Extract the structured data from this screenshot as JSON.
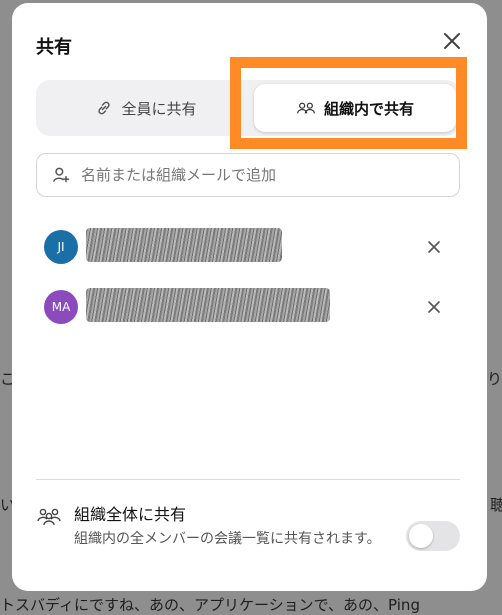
{
  "background": {
    "text_right_1": "り",
    "text_left_1": "こ",
    "text_right_2": "聴",
    "text_left_2": "い",
    "bottom_line": "トスバディにですね、あの、アプリケーションで、あの、Ping"
  },
  "dialog": {
    "title": "共有",
    "close_icon": "close-icon",
    "tabs": [
      {
        "label": "全員に共有",
        "icon": "link-icon",
        "selected": false
      },
      {
        "label": "組織内で共有",
        "icon": "people-icon",
        "selected": true
      }
    ],
    "search": {
      "placeholder": "名前または組織メールで追加",
      "value": "",
      "icon": "add-person-icon"
    },
    "members": [
      {
        "initials": "JI",
        "color": "#1a6fa6",
        "redacted": true
      },
      {
        "initials": "MA",
        "color": "#8c4bbd",
        "redacted": true
      }
    ],
    "org_share": {
      "title": "組織全体に共有",
      "description": "組織内の全メンバーの会議一覧に共有されます。",
      "enabled": false
    }
  },
  "highlight_color": "#ff8a26"
}
